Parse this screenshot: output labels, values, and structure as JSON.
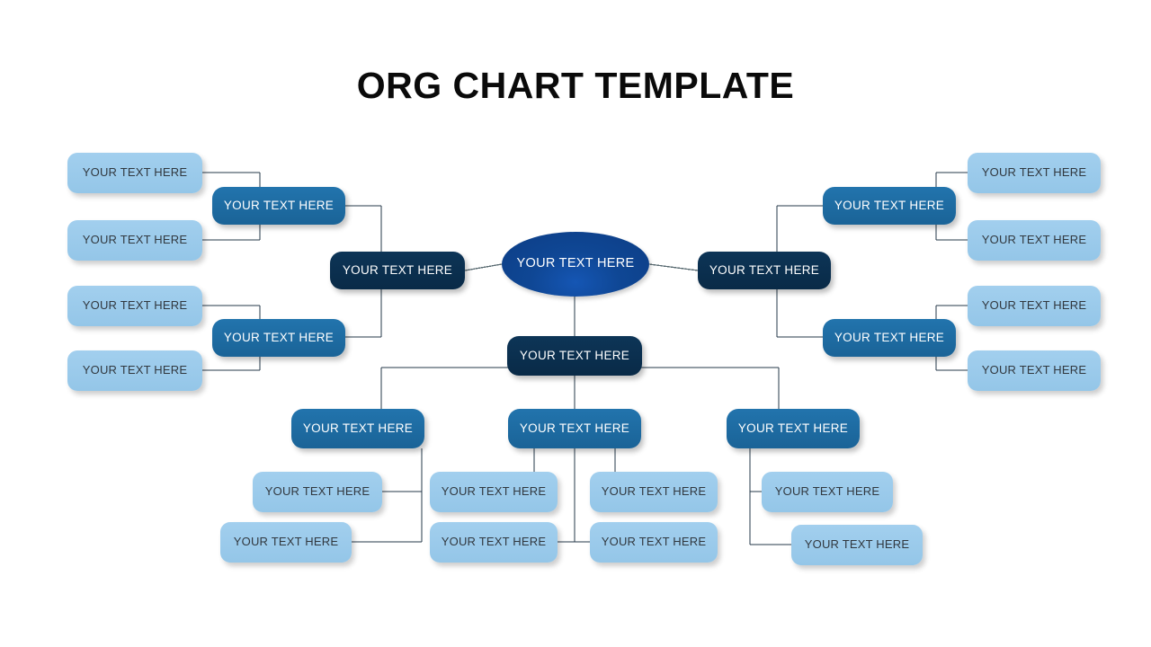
{
  "title": "ORG CHART TEMPLATE",
  "theme": {
    "background": "#ffffff",
    "title_color": "#0a0a0a",
    "root_blue": "#0f4795",
    "navy": "#0b3152",
    "mid_blue": "#1e6da6",
    "light_blue": "#9bcbeb",
    "light_text": "#31383f",
    "connector": "#25394a"
  },
  "label": "YOUR TEXT HERE",
  "nodes": {
    "root": {
      "label": "YOUR TEXT HERE",
      "level": "root",
      "shape": "ellipse"
    },
    "left_manager": {
      "label": "YOUR TEXT HERE",
      "level": "navy",
      "shape": "rounded-rect"
    },
    "left_sub_top": {
      "label": "YOUR TEXT HERE",
      "level": "mid",
      "shape": "rounded-rect"
    },
    "left_sub_bottom": {
      "label": "YOUR TEXT HERE",
      "level": "mid",
      "shape": "rounded-rect"
    },
    "left_leaf_1": {
      "label": "YOUR TEXT HERE",
      "level": "light",
      "shape": "rounded-rect"
    },
    "left_leaf_2": {
      "label": "YOUR TEXT HERE",
      "level": "light",
      "shape": "rounded-rect"
    },
    "left_leaf_3": {
      "label": "YOUR TEXT HERE",
      "level": "light",
      "shape": "rounded-rect"
    },
    "left_leaf_4": {
      "label": "YOUR TEXT HERE",
      "level": "light",
      "shape": "rounded-rect"
    },
    "right_manager": {
      "label": "YOUR TEXT HERE",
      "level": "navy",
      "shape": "rounded-rect"
    },
    "right_sub_top": {
      "label": "YOUR TEXT HERE",
      "level": "mid",
      "shape": "rounded-rect"
    },
    "right_sub_bottom": {
      "label": "YOUR TEXT HERE",
      "level": "mid",
      "shape": "rounded-rect"
    },
    "right_leaf_1": {
      "label": "YOUR TEXT HERE",
      "level": "light",
      "shape": "rounded-rect"
    },
    "right_leaf_2": {
      "label": "YOUR TEXT HERE",
      "level": "light",
      "shape": "rounded-rect"
    },
    "right_leaf_3": {
      "label": "YOUR TEXT HERE",
      "level": "light",
      "shape": "rounded-rect"
    },
    "right_leaf_4": {
      "label": "YOUR TEXT HERE",
      "level": "light",
      "shape": "rounded-rect"
    },
    "bottom_manager": {
      "label": "YOUR TEXT HERE",
      "level": "navy",
      "shape": "rounded-rect"
    },
    "bottom_sub_left": {
      "label": "YOUR TEXT HERE",
      "level": "mid",
      "shape": "rounded-rect"
    },
    "bottom_sub_center": {
      "label": "YOUR TEXT HERE",
      "level": "mid",
      "shape": "rounded-rect"
    },
    "bottom_sub_right": {
      "label": "YOUR TEXT HERE",
      "level": "mid",
      "shape": "rounded-rect"
    },
    "bottom_left_leaf_1": {
      "label": "YOUR TEXT HERE",
      "level": "light",
      "shape": "rounded-rect"
    },
    "bottom_left_leaf_2": {
      "label": "YOUR TEXT HERE",
      "level": "light",
      "shape": "rounded-rect"
    },
    "bottom_center_leaf_1": {
      "label": "YOUR TEXT HERE",
      "level": "light",
      "shape": "rounded-rect"
    },
    "bottom_center_leaf_2": {
      "label": "YOUR TEXT HERE",
      "level": "light",
      "shape": "rounded-rect"
    },
    "bottom_center_leaf_3": {
      "label": "YOUR TEXT HERE",
      "level": "light",
      "shape": "rounded-rect"
    },
    "bottom_center_leaf_4": {
      "label": "YOUR TEXT HERE",
      "level": "light",
      "shape": "rounded-rect"
    },
    "bottom_right_leaf_1": {
      "label": "YOUR TEXT HERE",
      "level": "light",
      "shape": "rounded-rect"
    },
    "bottom_right_leaf_2": {
      "label": "YOUR TEXT HERE",
      "level": "light",
      "shape": "rounded-rect"
    }
  },
  "counts": {
    "total_nodes": 27,
    "navy_nodes": 3,
    "mid_nodes": 7,
    "light_nodes": 16,
    "root_nodes": 1
  }
}
